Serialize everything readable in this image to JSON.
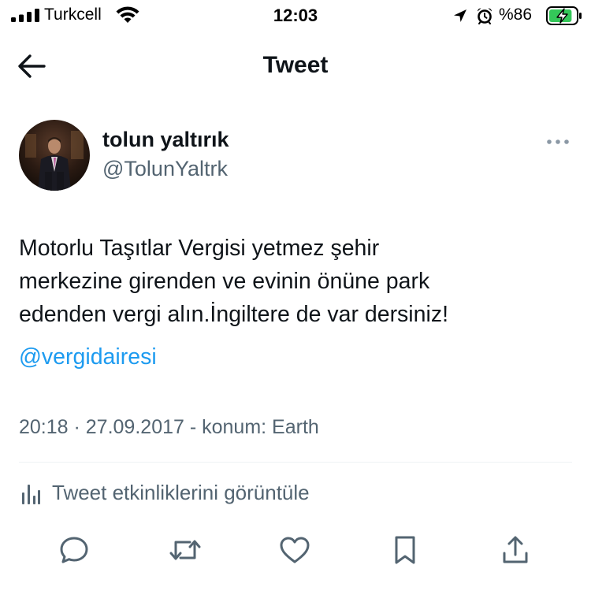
{
  "status_bar": {
    "carrier": "Turkcell",
    "time": "12:03",
    "battery_label": "%86",
    "battery_level": 0.86
  },
  "nav": {
    "title": "Tweet",
    "back_icon": "arrow-left-icon"
  },
  "tweet": {
    "author_name": "tolun yaltırık",
    "author_handle": "@TolunYaltrk",
    "text": "Motorlu Taşıtlar Vergisi yetmez şehir\nmerkezine girenden ve evinin önüne park\nedenden vergi alın.İngiltere de var dersiniz!",
    "mention": "@vergidairesi",
    "meta": "20:18 · 27.09.2017 - konum: Earth",
    "activity_label": "Tweet etkinliklerini görüntüle"
  },
  "actions": [
    "reply-icon",
    "retweet-icon",
    "like-icon",
    "bookmark-icon",
    "share-icon"
  ],
  "colors": {
    "text": "#0f1419",
    "secondary": "#536471",
    "link": "#1d9bf0",
    "divider": "#eff3f4",
    "battery_green": "#34c759"
  }
}
